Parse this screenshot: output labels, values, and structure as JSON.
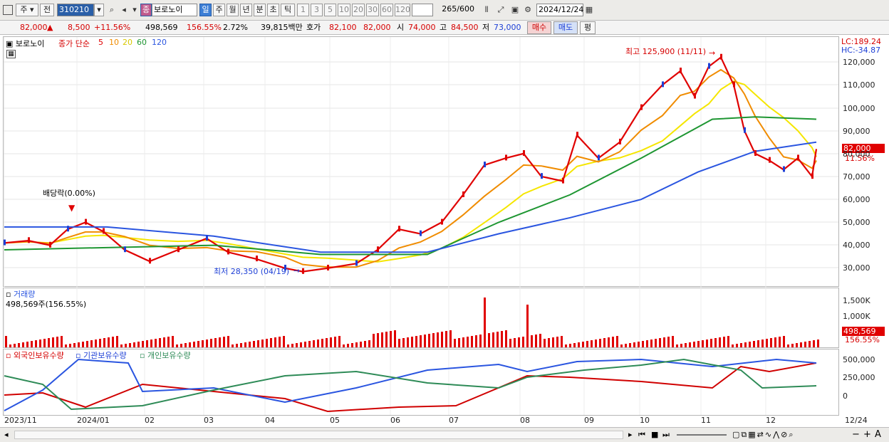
{
  "toolbar": {
    "period_type": "주",
    "mode": "전",
    "code": "310210",
    "name": "보로노이",
    "name_tag": "종",
    "tf": [
      "일",
      "주",
      "월",
      "년",
      "분",
      "초",
      "틱"
    ],
    "nums": [
      "1",
      "3",
      "5",
      "10",
      "20",
      "30",
      "60",
      "120"
    ],
    "count": "265",
    "count_total": "/600",
    "date": "2024/12/24"
  },
  "quote": {
    "price": "82,000",
    "arrow": "▲",
    "change": "8,500",
    "pct": "+11.56%",
    "volume": "498,569",
    "vol_pct": "156.55%",
    "turnover": "2.72%",
    "amount": "39,815백만",
    "ask_label": "호가",
    "ask": "82,100",
    "bid": "82,000",
    "open_label": "시",
    "open": "74,000",
    "high_label": "고",
    "high": "84,500",
    "low_label": "저",
    "low": "73,000",
    "buy": "매수",
    "sell": "매도",
    "eval": "평"
  },
  "price_panel": {
    "name": "보로노이",
    "ma_label": "종가 단순",
    "ma": [
      "5",
      "10",
      "20",
      "60",
      "120"
    ],
    "ma_colors": [
      "#e00000",
      "#f08c00",
      "#f5e600",
      "#1e9632",
      "#2a55e0"
    ],
    "lc": "LC:189.24",
    "hc": "HC:-34.87",
    "high_note": "최고 125,900 (11/11)",
    "low_note": "최저 28,350 (04/19)",
    "div_note": "배당락(0.00%)",
    "last_price": "82,000",
    "last_pct": "11.56%",
    "yticks": [
      "120,000",
      "110,000",
      "100,000",
      "90,000",
      "80,000",
      "70,000",
      "60,000",
      "50,000",
      "40,000",
      "30,000"
    ]
  },
  "volume_panel": {
    "title": "거래량",
    "value": "498,569주(156.55%)",
    "yticks": [
      "1,500K",
      "1,000K"
    ],
    "last": "498,569",
    "last_pct": "156.55%"
  },
  "holding_panel": {
    "labels": [
      "외국인보유수량",
      "기관보유수량",
      "개인보유수량"
    ],
    "colors": [
      "#d00000",
      "#2a55e0",
      "#2e8b57"
    ],
    "yticks": [
      "500,000",
      "250,000",
      "0"
    ]
  },
  "dates": [
    "2023/11",
    "2024/01",
    "02",
    "03",
    "04",
    "05",
    "06",
    "07",
    "08",
    "09",
    "10",
    "11",
    "12",
    "12/24"
  ],
  "icons": [
    "chart-icon",
    "search-icon",
    "speaker-icon",
    "settings-icon",
    "calendar-icon"
  ]
}
